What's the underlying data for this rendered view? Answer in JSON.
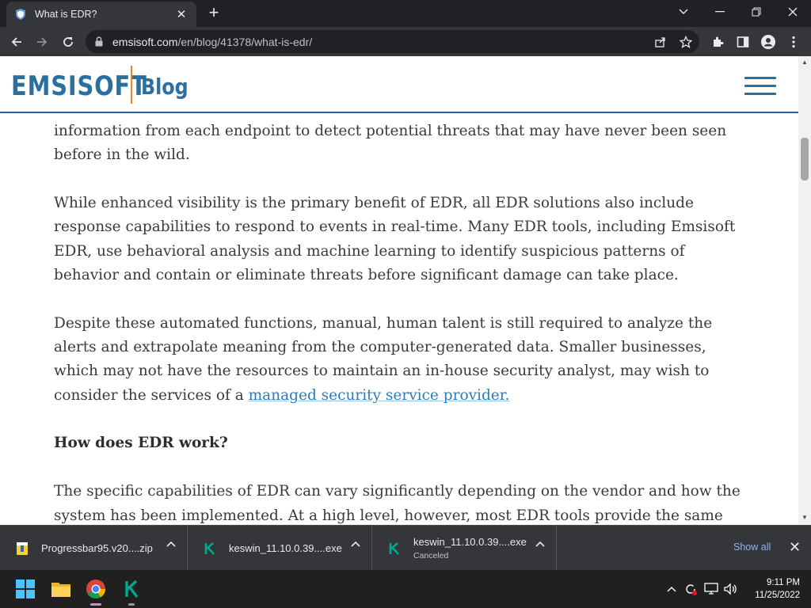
{
  "browser": {
    "tab_title": "What is EDR?",
    "url_host": "emsisoft.com",
    "url_path": "/en/blog/41378/what-is-edr/"
  },
  "site": {
    "logo": "EMSISOFT",
    "section": "Blog"
  },
  "article": {
    "p1": "information from each endpoint to detect potential threats that may have never been seen before in the wild.",
    "p2": "While enhanced visibility is the primary benefit of EDR, all EDR solutions also include response capabilities to respond to events in real-time. Many EDR tools, including Emsisoft EDR, use behavioral analysis and machine learning to identify suspicious patterns of behavior and contain or eliminate threats before significant damage can take place.",
    "p3_text": "Despite these automated functions, manual, human talent is still required to analyze the alerts and extrapolate meaning from the computer-generated data. Smaller businesses, which may not have the resources to maintain an in-house security analyst, may wish to consider the services of a ",
    "p3_link": "managed security service provider.",
    "heading": "How does EDR work?",
    "p4": "The specific capabilities of EDR can vary significantly depending on the vendor and how the system has been implemented. At a high level, however, most EDR tools provide the same core"
  },
  "downloads": {
    "items": [
      {
        "name": "Progressbar95.v20....zip",
        "status": ""
      },
      {
        "name": "keswin_11.10.0.39....exe",
        "status": ""
      },
      {
        "name": "keswin_11.10.0.39....exe",
        "status": "Canceled"
      }
    ],
    "show_all": "Show all"
  },
  "taskbar": {
    "time": "9:11 PM",
    "date": "11/25/2022"
  },
  "colors": {
    "brand": "#2b6f9e",
    "accent": "#e8842a",
    "link": "#2b7bb9",
    "kaspersky": "#00a88e"
  }
}
